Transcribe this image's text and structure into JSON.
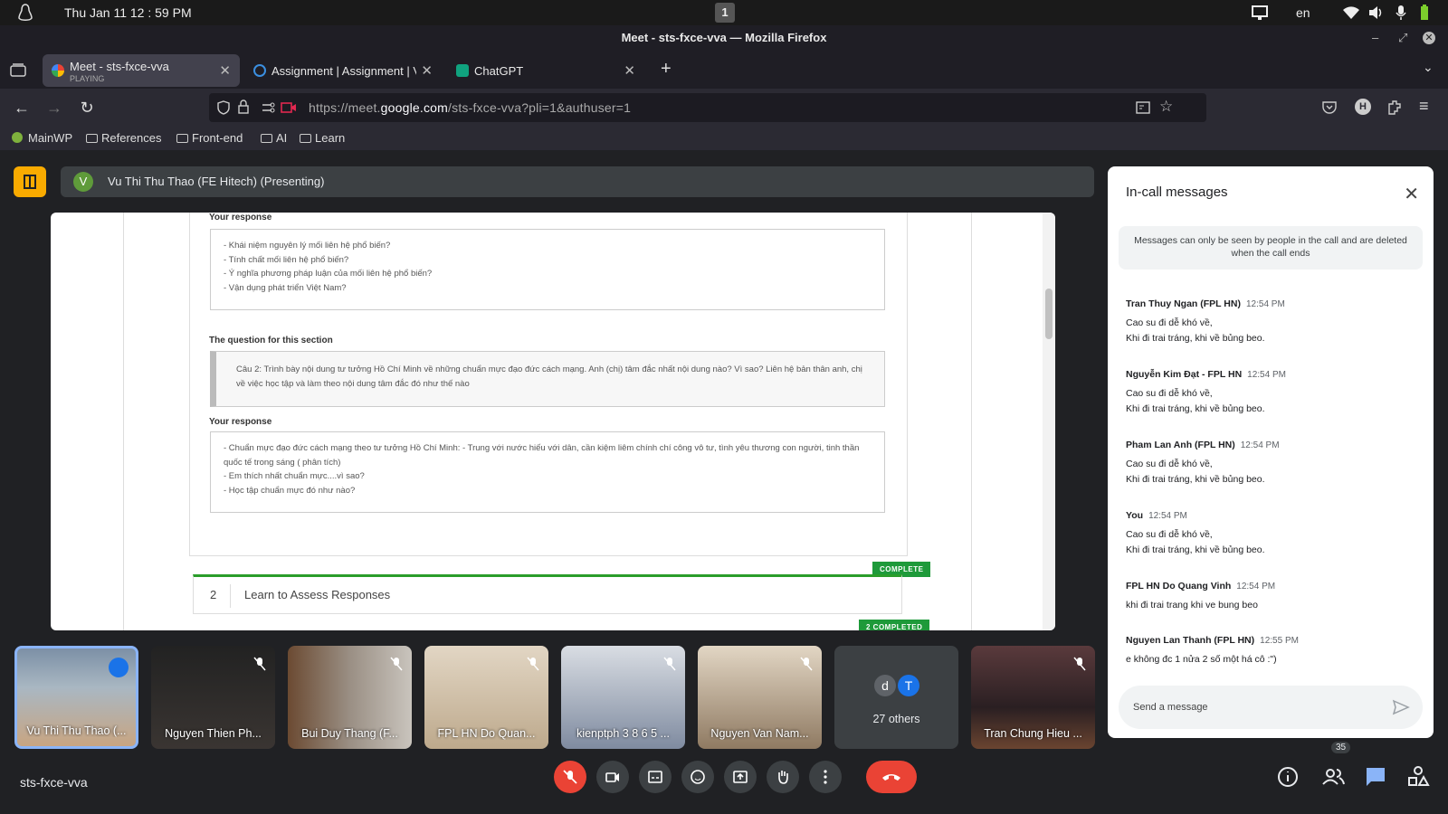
{
  "os": {
    "clock": "Thu Jan 11 12 : 59 PM",
    "workspace": "1",
    "lang": "en"
  },
  "window": {
    "title": "Meet - sts-fxce-vva — Mozilla Firefox"
  },
  "tabs": [
    {
      "title": "Meet - sts-fxce-vva",
      "sub": "PLAYING"
    },
    {
      "title": "Assignment | Assignment | V"
    },
    {
      "title": "ChatGPT"
    }
  ],
  "url": {
    "pre": "https://meet.",
    "host": "google.com",
    "path": "/sts-fxce-vva?pli=1&authuser=1"
  },
  "bookmarks": [
    "MainWP",
    "References",
    "Front-end",
    "AI",
    "Learn"
  ],
  "presenter": {
    "avatar": "V",
    "name": "Vu Thi Thu Thao (FE Hitech) (Presenting)"
  },
  "shared": {
    "label1": "Your response",
    "resp1": [
      "- Khái niệm nguyên lý mối liên hệ phổ biến?",
      "- Tính chất mối liên hệ phổ biến?",
      "- Ý nghĩa phương pháp luận của mối liên hệ phổ biến?",
      "- Vận dụng phát triển Việt Nam?"
    ],
    "label2": "The question for this section",
    "question": "Câu 2: Trình bày nội dung tư tưởng Hồ Chí Minh về những chuẩn mực đạo đức cách mạng. Anh (chị) tâm đắc nhất nội dung nào? Vì sao? Liên hệ bản thân anh, chị về việc học tập và làm theo nội dung tâm đắc đó như thế nào",
    "label3": "Your response",
    "resp2": [
      "- Chuẩn mực đạo đức cách mạng theo tư tưởng Hồ Chí Minh: - Trung với nước hiếu với dân, cần kiệm liêm chính chí công vô tư, tình yêu thương con người, tinh thần quốc tế trong sáng ( phân tích)",
      "- Em thích nhất chuẩn mực....vì sao?",
      "- Học tập chuẩn mực đó như nào?"
    ],
    "badge1": "COMPLETE",
    "sec_num": "2",
    "sec_title": "Learn to Assess Responses",
    "badge2": "2 COMPLETED"
  },
  "participants": [
    {
      "name": "Vu Thi Thu Thao (..."
    },
    {
      "name": "Nguyen Thien Ph..."
    },
    {
      "name": "Bui Duy Thang (F..."
    },
    {
      "name": "FPL HN Do Quan..."
    },
    {
      "name": "kienptph 3 8 6 5 ..."
    },
    {
      "name": "Nguyen Van Nam..."
    },
    {
      "others": "27 others",
      "a1": "d",
      "a2": "T"
    },
    {
      "name": "Tran Chung Hieu ..."
    }
  ],
  "meeting_code": "sts-fxce-vva",
  "people_count": "35",
  "chat": {
    "title": "In-call messages",
    "note": "Messages can only be seen by people in the call and are deleted when the call ends",
    "messages": [
      {
        "sender": "Tran Thuy Ngan (FPL HN)",
        "time": "12:54 PM",
        "lines": [
          "Cao su đi dễ khó về,",
          "Khi đi trai tráng, khi về bủng beo."
        ]
      },
      {
        "sender": "Nguyễn Kim Đạt - FPL HN",
        "time": "12:54 PM",
        "lines": [
          "Cao su đi dễ khó về,",
          "Khi đi trai tráng, khi về bủng beo."
        ]
      },
      {
        "sender": "Pham Lan Anh (FPL HN)",
        "time": "12:54 PM",
        "lines": [
          "Cao su đi dễ khó về,",
          "Khi đi trai tráng, khi về bủng beo."
        ]
      },
      {
        "sender": "You",
        "time": "12:54 PM",
        "lines": [
          "Cao su đi dễ khó về,",
          "Khi đi trai tráng, khi về bủng beo."
        ]
      },
      {
        "sender": "FPL HN Do Quang Vinh",
        "time": "12:54 PM",
        "lines": [
          "khi đi trai trang khi ve bung beo"
        ]
      },
      {
        "sender": "Nguyen Lan Thanh (FPL HN)",
        "time": "12:55 PM",
        "lines": [
          "e không đc 1 nửa 2 số một há cô :\")"
        ]
      }
    ],
    "placeholder": "Send a message"
  }
}
